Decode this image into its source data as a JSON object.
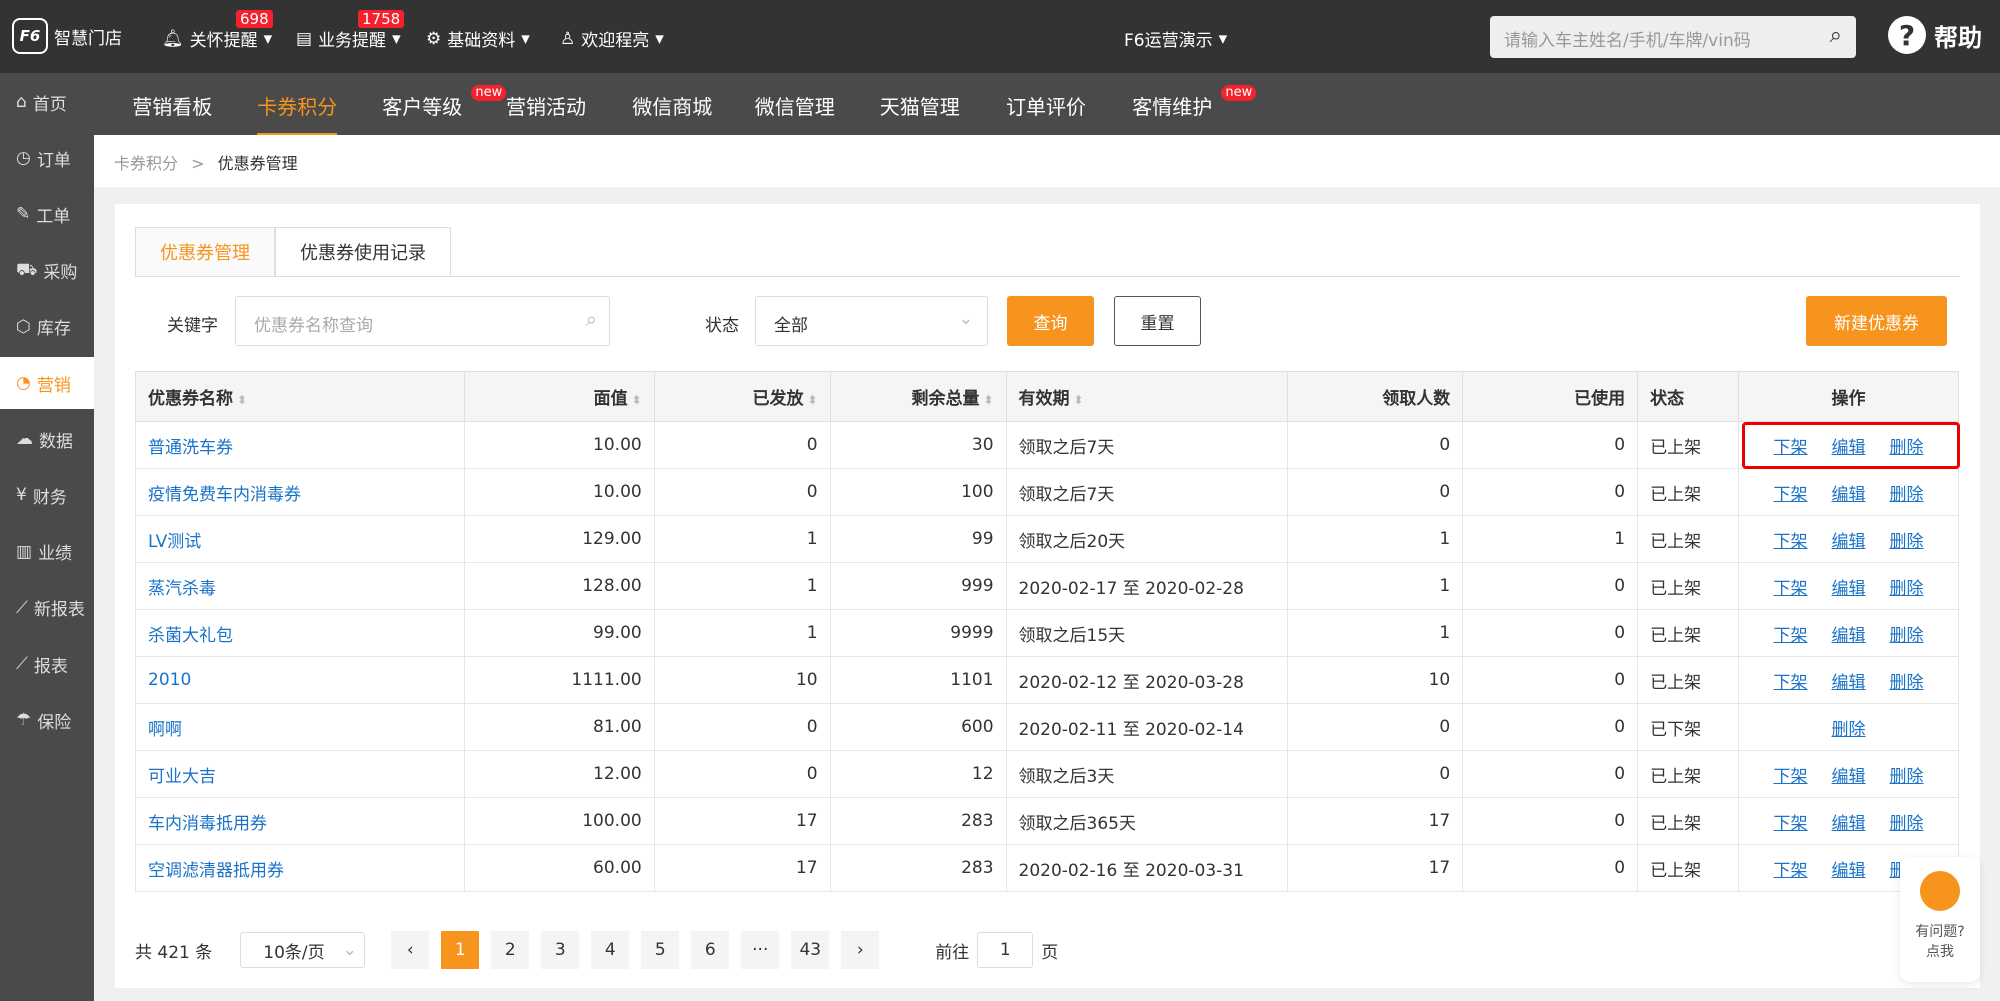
{
  "topbar": {
    "logo_mark": "F6",
    "logo_text": "智慧门店",
    "care": "关怀提醒",
    "care_count": "698",
    "biz": "业务提醒",
    "biz_count": "1758",
    "basic": "基础资料",
    "user": "欢迎程亮",
    "store": "F6运营演示",
    "search_placeholder": "请输入车主姓名/手机/车牌/vin码",
    "help": "帮助"
  },
  "nav": [
    {
      "label": "营销看板"
    },
    {
      "label": "卡券积分",
      "active": true
    },
    {
      "label": "客户等级",
      "new": "new"
    },
    {
      "label": "营销活动"
    },
    {
      "label": "微信商城"
    },
    {
      "label": "微信管理"
    },
    {
      "label": "天猫管理"
    },
    {
      "label": "订单评价"
    },
    {
      "label": "客情维护",
      "new": "new"
    }
  ],
  "sidebar": [
    {
      "icon": "⌂",
      "label": "首页"
    },
    {
      "icon": "◷",
      "label": "订单"
    },
    {
      "icon": "✎",
      "label": "工单"
    },
    {
      "icon": "⛟",
      "label": "采购"
    },
    {
      "icon": "⬡",
      "label": "库存"
    },
    {
      "icon": "◔",
      "label": "营销"
    },
    {
      "icon": "☁",
      "label": "数据"
    },
    {
      "icon": "¥",
      "label": "财务"
    },
    {
      "icon": "▥",
      "label": "业绩"
    },
    {
      "icon": "⟋",
      "label": "新报表"
    },
    {
      "icon": "⟋",
      "label": "报表"
    },
    {
      "icon": "☂",
      "label": "保险"
    }
  ],
  "breadcrumb": {
    "parent": "卡券积分",
    "sep": ">",
    "current": "优惠券管理"
  },
  "tabs": [
    "优惠券管理",
    "优惠券使用记录"
  ],
  "filter": {
    "keyword_label": "关键字",
    "keyword_placeholder": "优惠券名称查询",
    "status_label": "状态",
    "status_value": "全部",
    "query": "查询",
    "reset": "重置",
    "create": "新建优惠券"
  },
  "table": {
    "headers": [
      "优惠券名称",
      "面值",
      "已发放",
      "剩余总量",
      "有效期",
      "领取人数",
      "已使用",
      "状态",
      "操作"
    ],
    "rows": [
      [
        "普通洗车券",
        "10.00",
        "0",
        "30",
        "领取之后7天",
        "0",
        "0",
        "已上架"
      ],
      [
        "疫情免费车内消毒券",
        "10.00",
        "0",
        "100",
        "领取之后7天",
        "0",
        "0",
        "已上架"
      ],
      [
        "LV测试",
        "129.00",
        "1",
        "99",
        "领取之后20天",
        "1",
        "1",
        "已上架"
      ],
      [
        "蒸汽杀毒",
        "128.00",
        "1",
        "999",
        "2020-02-17 至 2020-02-28",
        "1",
        "0",
        "已上架"
      ],
      [
        "杀菌大礼包",
        "99.00",
        "1",
        "9999",
        "领取之后15天",
        "1",
        "0",
        "已上架"
      ],
      [
        "2010",
        "1111.00",
        "10",
        "1101",
        "2020-02-12 至 2020-03-28",
        "10",
        "0",
        "已上架"
      ],
      [
        "啊啊",
        "81.00",
        "0",
        "600",
        "2020-02-11 至 2020-02-14",
        "0",
        "0",
        "已下架"
      ],
      [
        "可业大吉",
        "12.00",
        "0",
        "12",
        "领取之后3天",
        "0",
        "0",
        "已上架"
      ],
      [
        "车内消毒抵用券",
        "100.00",
        "17",
        "283",
        "领取之后365天",
        "17",
        "0",
        "已上架"
      ],
      [
        "空调滤清器抵用券",
        "60.00",
        "17",
        "283",
        "2020-02-16 至 2020-03-31",
        "17",
        "0",
        "已上架"
      ]
    ],
    "actions": {
      "off": "下架",
      "edit": "编辑",
      "del": "删除"
    }
  },
  "pager": {
    "total": "共 421 条",
    "size": "10条/页",
    "pages": [
      "1",
      "2",
      "3",
      "4",
      "5",
      "6",
      "···",
      "43"
    ],
    "current": "1",
    "goto_label": "前往",
    "goto_value": "1",
    "page_label": "页"
  },
  "float_help": {
    "line1": "有问题?",
    "line2": "点我"
  },
  "colors": {
    "accent": "#f7941d",
    "link": "#1a73c9",
    "badge": "#f5222d"
  }
}
